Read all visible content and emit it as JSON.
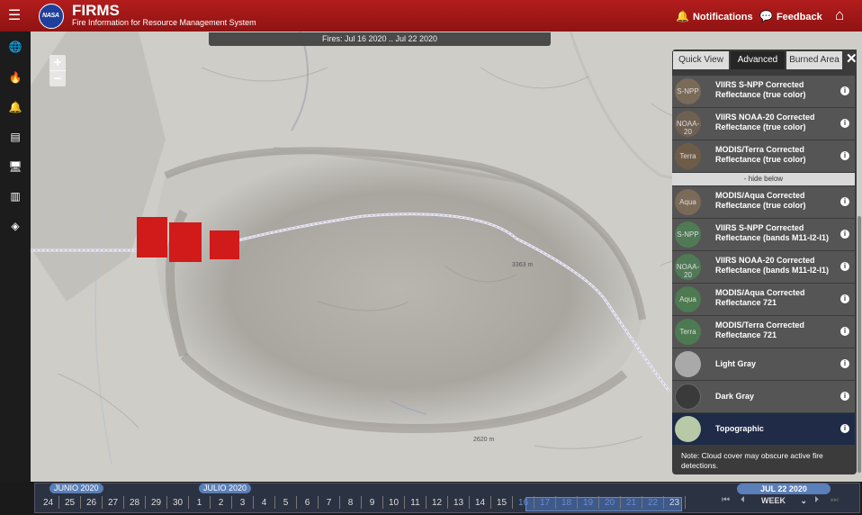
{
  "header": {
    "logo_text": "NASA",
    "title": "FIRMS",
    "subtitle": "Fire Information for Resource Management System",
    "notifications_label": "Notifications",
    "feedback_label": "Feedback",
    "menu_icon": "hamburger-icon",
    "home_icon": "home-icon",
    "bar_color": "#a51a1a"
  },
  "sidebar": {
    "items": [
      {
        "icon": "globe-icon",
        "glyph": "🌐"
      },
      {
        "icon": "fire-icon",
        "glyph": "🔥"
      },
      {
        "icon": "bell-icon",
        "glyph": "🔔"
      },
      {
        "icon": "archive-icon",
        "glyph": "▤"
      },
      {
        "icon": "monitor-icon",
        "glyph": "🖥"
      },
      {
        "icon": "storage-icon",
        "glyph": "▥"
      },
      {
        "icon": "cube-icon",
        "glyph": "◈"
      }
    ]
  },
  "map": {
    "fires_banner": "Fires: Jul 16 2020 .. Jul 22 2020",
    "zoom_in": "+",
    "zoom_out": "−",
    "fire_color": "#d11a1a",
    "place_labels": [
      "3363 m",
      "2620 m"
    ]
  },
  "panel": {
    "tabs": [
      "Quick View",
      "Advanced",
      "Burned Area"
    ],
    "active_tab": "Advanced",
    "close_label": "✕",
    "hide_below_label": "- hide below",
    "layers": [
      {
        "name": "VIIRS S-NPP Corrected Reflectance (true color)",
        "thumb_label": "S-NPP",
        "thumb_color": "#7a6a58"
      },
      {
        "name": "VIIRS NOAA-20 Corrected Reflectance (true color)",
        "thumb_label": "NOAA-20",
        "thumb_color": "#6f6152"
      },
      {
        "name": "MODIS/Terra Corrected Reflectance (true color)",
        "thumb_label": "Terra",
        "thumb_color": "#6e5c48"
      },
      {
        "name": "MODIS/Aqua Corrected Reflectance (true color)",
        "thumb_label": "Aqua",
        "thumb_color": "#7a6a58"
      },
      {
        "name": "VIIRS S-NPP Corrected Reflectance (bands M11-I2-I1)",
        "thumb_label": "S-NPP",
        "thumb_color": "#4f7a55"
      },
      {
        "name": "VIIRS NOAA-20 Corrected Reflectance (bands M11-I2-I1)",
        "thumb_label": "NOAA-20",
        "thumb_color": "#4f7a55"
      },
      {
        "name": "MODIS/Aqua Corrected Reflectance 721",
        "thumb_label": "Aqua",
        "thumb_color": "#4d7a50"
      },
      {
        "name": "MODIS/Terra Corrected Reflectance 721",
        "thumb_label": "Terra",
        "thumb_color": "#4d7a50"
      },
      {
        "name": "Light Gray",
        "thumb_label": "",
        "thumb_color": "#a9a9a9"
      },
      {
        "name": "Dark Gray",
        "thumb_label": "",
        "thumb_color": "#3a3a3a"
      },
      {
        "name": "Topographic",
        "thumb_label": "",
        "thumb_color": "#b8c9a8"
      }
    ],
    "selected_layer": "Topographic",
    "note": "Note: Cloud cover may obscure active fire detections."
  },
  "timeline": {
    "month_labels": [
      "JUNIO 2020",
      "JULIO 2020"
    ],
    "days": [
      "24",
      "25",
      "26",
      "27",
      "28",
      "29",
      "30",
      "1",
      "2",
      "3",
      "4",
      "5",
      "6",
      "7",
      "8",
      "9",
      "10",
      "11",
      "12",
      "13",
      "14",
      "15",
      "16",
      "17",
      "18",
      "19",
      "20",
      "21",
      "22",
      "23"
    ],
    "selected_range": [
      "16",
      "22"
    ],
    "current_date": "JUL 22 2020",
    "interval": "WEEK",
    "controls": {
      "first": "⏮",
      "prev": "⏴",
      "next": "⏵",
      "last": "⏭"
    },
    "accent": "#5b7fb8"
  }
}
